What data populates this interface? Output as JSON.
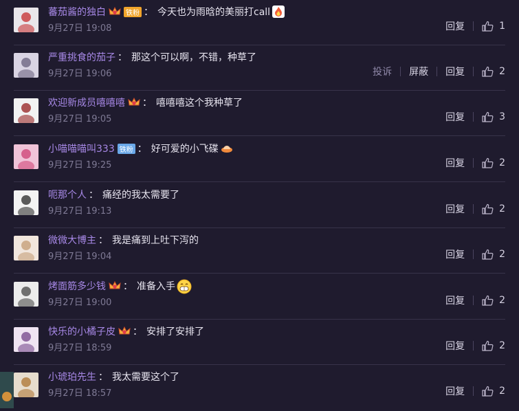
{
  "actions": {
    "reply": "回复",
    "report": "投诉",
    "block": "屏蔽"
  },
  "comments": [
    {
      "user": "蕃茄酱的独白",
      "badge": "铁粉",
      "badge_style": "gold",
      "crown": true,
      "text": "今天也为雨晗的美丽打call",
      "emoji": "fire-emoji",
      "time": "9月27日 19:08",
      "likes": "1"
    },
    {
      "user": "严重挑食的茄子",
      "badge": "",
      "crown": false,
      "text": "那这个可以啊，不错，种草了",
      "time": "9月27日 19:06",
      "likes": "2",
      "show_report": true
    },
    {
      "user": "欢迎新成员嘻嘻嘻",
      "badge": "",
      "crown": true,
      "text": "嘻嘻嘻这个我种草了",
      "time": "9月27日 19:05",
      "likes": "3"
    },
    {
      "user": "小喵喵喵叫333",
      "badge": "铁粉",
      "badge_style": "blue",
      "crown": false,
      "text": "好可爱的小飞碟",
      "emoji": "ufo-emoji",
      "time": "9月27日 19:25",
      "likes": "2"
    },
    {
      "user": "呃那个人",
      "badge": "",
      "crown": false,
      "text": "痛经的我太需要了",
      "time": "9月27日 19:13",
      "likes": "2"
    },
    {
      "user": "微微大博主",
      "badge": "",
      "crown": false,
      "text": "我是痛到上吐下泻的",
      "time": "9月27日 19:04",
      "likes": "2"
    },
    {
      "user": "烤面筋多少钱",
      "badge": "",
      "crown": true,
      "text": "准备入手",
      "emoji": "grin-emoji",
      "time": "9月27日 19:00",
      "likes": "2"
    },
    {
      "user": "快乐的小橘子皮",
      "badge": "",
      "crown": true,
      "text": "安排了安排了",
      "time": "9月27日 18:59",
      "likes": "2"
    },
    {
      "user": "小琥珀先生",
      "badge": "",
      "crown": false,
      "text": "我太需要这个了",
      "time": "9月27日 18:57",
      "likes": "2"
    }
  ],
  "colors": {
    "background": "#1f1b2e",
    "username": "#a788e6",
    "text": "#e7e4ef",
    "time": "#7f7a95"
  }
}
